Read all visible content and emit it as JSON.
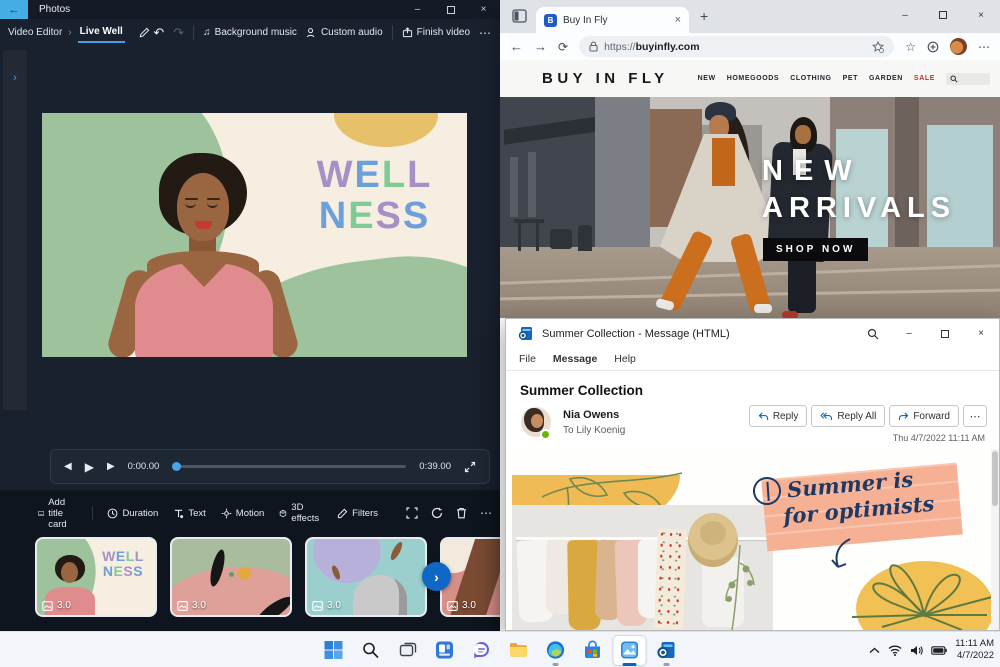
{
  "photos": {
    "title": "Photos",
    "breadcrumb": {
      "root": "Video Editor",
      "chevron": "›",
      "current": "Live Well"
    },
    "toolbar": {
      "undo": "↶",
      "redo": "↷",
      "background_music": "Background music",
      "custom_audio": "Custom audio",
      "finish_video": "Finish video",
      "more": "⋯"
    },
    "side_chevron": "›",
    "wellness": {
      "line1": [
        {
          "ch": "W",
          "color": "#a691c6"
        },
        {
          "ch": "E",
          "color": "#6d9fd8"
        },
        {
          "ch": "L",
          "color": "#7ecb96"
        },
        {
          "ch": "L",
          "color": "#a691c6"
        }
      ],
      "line2": [
        {
          "ch": "N",
          "color": "#6d9fd8"
        },
        {
          "ch": "E",
          "color": "#7ecb96"
        },
        {
          "ch": "S",
          "color": "#a691c6"
        },
        {
          "ch": "S",
          "color": "#6d9fd8"
        }
      ]
    },
    "playback": {
      "prev": "◀",
      "play": "▶",
      "next": "▶",
      "current": "0:00.00",
      "total": "0:39.00"
    },
    "timeline": {
      "add_title_card": "Add title card",
      "duration": "Duration",
      "text": "Text",
      "motion": "Motion",
      "effects_3d": "3D effects",
      "filters": "Filters",
      "more": "⋯"
    },
    "clips": [
      {
        "duration": "3.0"
      },
      {
        "duration": "3.0"
      },
      {
        "duration": "3.0"
      },
      {
        "duration": "3.0"
      }
    ],
    "next_arrow": "›"
  },
  "edge": {
    "tab_title": "Buy In Fly",
    "favicon_letter": "B",
    "tab_close": "×",
    "new_tab": "+",
    "back": "←",
    "forward": "→",
    "refresh": "⟳",
    "url_scheme": "https://",
    "url_host": "buyinfly.com",
    "more": "⋯"
  },
  "site": {
    "logo": "BUY IN FLY",
    "nav": [
      "NEW",
      "HOMEGOODS",
      "CLOTHING",
      "PET",
      "GARDEN",
      "SALE"
    ],
    "sale_color": "#b5342c",
    "hero_line1": "NEW",
    "hero_line2": "ARRIVALS",
    "cta": "SHOP NOW"
  },
  "outlook": {
    "window_title": "Summer Collection - Message (HTML)",
    "menu": [
      "File",
      "Message",
      "Help"
    ],
    "subject": "Summer Collection",
    "sender": "Nia Owens",
    "recipient": "To Lily Koenig",
    "actions": [
      "Reply",
      "Reply All",
      "Forward"
    ],
    "more": "⋯",
    "timestamp": "Thu 4/7/2022 11:11 AM",
    "graphic_line1": "Summer is",
    "graphic_line2": "for optimists"
  },
  "taskbar": {
    "time": "11:11 AM",
    "date": "4/7/2022"
  },
  "colors": {
    "photos_accent": "#4b9ce0",
    "outlook_blue": "#0f6cbd",
    "taskbar_focus": "#0067c0"
  }
}
